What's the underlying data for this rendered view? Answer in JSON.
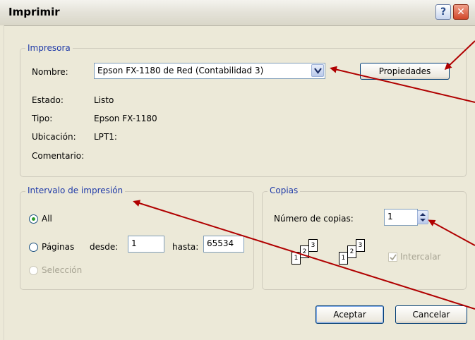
{
  "window": {
    "title": "Imprimir",
    "help_glyph": "?",
    "close_glyph": "✕"
  },
  "printer": {
    "legend": "Impresora",
    "name_label": "Nombre:",
    "name_value": "Epson FX-1180 de Red (Contabilidad 3)",
    "properties_button": "Propiedades",
    "status_label": "Estado:",
    "status_value": "Listo",
    "type_label": "Tipo:",
    "type_value": "Epson FX-1180",
    "location_label": "Ubicación:",
    "location_value": "LPT1:",
    "comment_label": "Comentario:",
    "comment_value": ""
  },
  "print_range": {
    "legend": "Intervalo de impresión",
    "all_label": "All",
    "pages_label": "Páginas",
    "from_label": "desde:",
    "from_value": "1",
    "to_label": "hasta:",
    "to_value": "65534",
    "selection_label": "Selección",
    "selected": "all"
  },
  "copies": {
    "legend": "Copias",
    "count_label": "Número de copias:",
    "count_value": "1",
    "collate_label": "Intercalar",
    "collate_checked": true,
    "collate_enabled": false,
    "page_numbers": [
      "1",
      "2",
      "3"
    ]
  },
  "buttons": {
    "ok": "Aceptar",
    "cancel": "Cancelar"
  },
  "colors": {
    "annotation_arrow": "#b00000",
    "legend_text": "#1f3aa8"
  }
}
